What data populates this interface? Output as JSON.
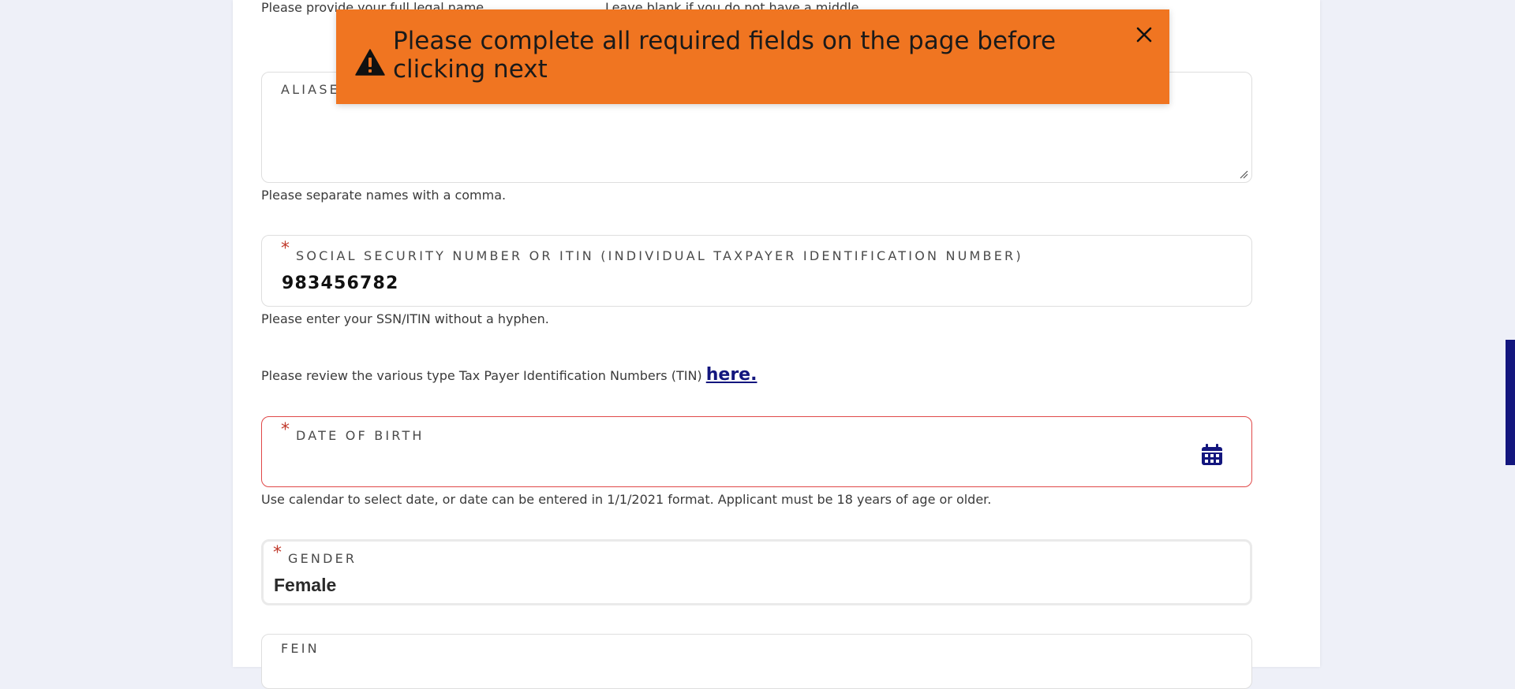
{
  "top_help": {
    "full_name": "Please provide your full legal name.",
    "middle": "Leave blank if you do not have a middle"
  },
  "toast": {
    "message": "Please complete all required fields on the page before clicking next",
    "icon": "warning-icon",
    "close_icon": "close-icon",
    "bg_color": "#f07521"
  },
  "aliases": {
    "label": "ALIASES",
    "help": "Please separate names with a comma."
  },
  "ssn": {
    "required_mark": "*",
    "label": "SOCIAL SECURITY NUMBER OR ITIN (INDIVIDUAL TAXPAYER IDENTIFICATION NUMBER)",
    "value": "983456782",
    "help": "Please enter your SSN/ITIN without a hyphen."
  },
  "tin_review": {
    "text": "Please review the various type Tax Payer Identification Numbers (TIN) ",
    "link": "here."
  },
  "dob": {
    "required_mark": "*",
    "label": "DATE OF BIRTH",
    "value": "",
    "icon": "calendar-icon",
    "help": "Use calendar to select date, or date can be entered in 1/1/2021 format. Applicant must be 18 years of age or older."
  },
  "gender": {
    "required_mark": "*",
    "label": "GENDER",
    "value": "Female"
  },
  "fein": {
    "label": "FEIN"
  },
  "colors": {
    "accent": "#13167e",
    "error_border": "#e04848",
    "required": "#c0392b"
  }
}
